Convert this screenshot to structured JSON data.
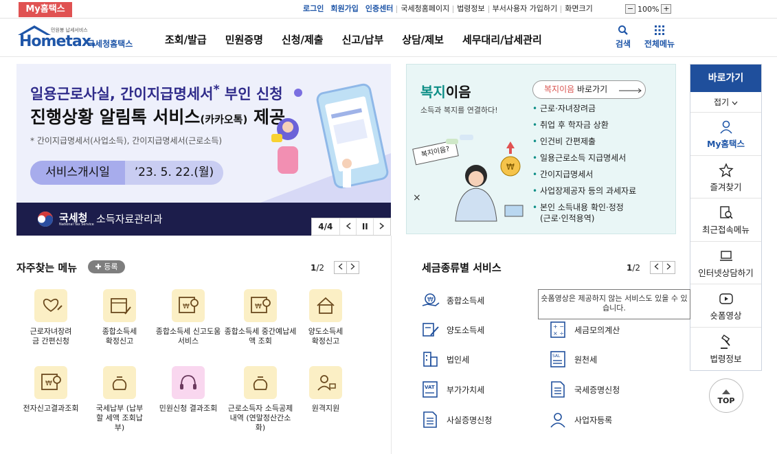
{
  "topbar": {
    "my_hometax": "My홈택스",
    "links": [
      "로그인",
      "회원가입",
      "인증센터",
      "국세청홈페이지",
      "법령정보",
      "부서사용자 가입하기",
      "화면크기"
    ],
    "zoom": "100%"
  },
  "header": {
    "logo_top": "민원봉 납세서비스",
    "logo_text": "Hometax.",
    "logo_sub": "국세청홈택스",
    "nav": [
      "조회/발급",
      "민원증명",
      "신청/제출",
      "신고/납부",
      "상담/제보",
      "세무대리/납세관리"
    ],
    "search": "검색",
    "all_menu": "전체메뉴"
  },
  "banner": {
    "line1": "일용근로사실, 간이지급명세서",
    "line1_star": "*",
    "line1_end": " 부인 신청",
    "line2": "진행상황 알림톡 서비스",
    "line2_small": "(카카오톡)",
    "line2_end": " 제공",
    "note": "* 간이지급명세서(사업소득), 간이지급명세서(근로소득)",
    "date_label": "서비스개시일",
    "date_value": "’23. 5. 22.(월)",
    "agency": "국세청",
    "agency_en": "National Tax Service",
    "dept": "소득자료관리과",
    "page": "4/4",
    "pause": "II"
  },
  "welfare": {
    "title_a": "복지",
    "title_b": "이음",
    "sub": "소득과 복지를 연결하다!",
    "btn_a": "복지이음",
    "btn_b": " 바로가기",
    "bubble": "복지이음?",
    "items": [
      "근로·자녀장려금",
      "취업 후 학자금 상환",
      "인건비 간편제출",
      "일용근로소득 지급명세서",
      "간이지급명세서",
      "사업장제공자 등의 과세자료",
      "본인 소득내용 확인·정정 (근로·인적용역)"
    ]
  },
  "quick": {
    "title": "바로가기",
    "fold": "접기",
    "items": [
      "My홈택스",
      "즐겨찾기",
      "최근접속메뉴",
      "인터넷상담하기",
      "숏폼영상",
      "법령정보"
    ],
    "top": "TOP"
  },
  "frequent": {
    "title": "자주찾는 메뉴",
    "add": "등록",
    "page_cur": "1",
    "page_total": "/2",
    "tiles": [
      "근로자녀장려금 간편신청",
      "종합소득세 확정신고",
      "종합소득세 신고도움 서비스",
      "종합소득세 중간예납세액 조회",
      "양도소득세 확정신고",
      "전자신고결과조회",
      "국세납부 (납부할 세액 조회납부)",
      "민원신청 결과조회",
      "근로소득자 소득공제 내역 (연말정산간소화)",
      "원격지원"
    ]
  },
  "taxtypes": {
    "title": "세금종류별 서비스",
    "page_cur": "1",
    "page_total": "/2",
    "items": [
      "종합소득세",
      "양도소득세",
      "세금모의계산",
      "법인세",
      "원천세",
      "부가가치세",
      "국세증명신청",
      "사실증명신청",
      "사업자등록"
    ],
    "tooltip": "숏폼영상은 제공하지 않는 서비스도 있을 수 있습니다."
  }
}
